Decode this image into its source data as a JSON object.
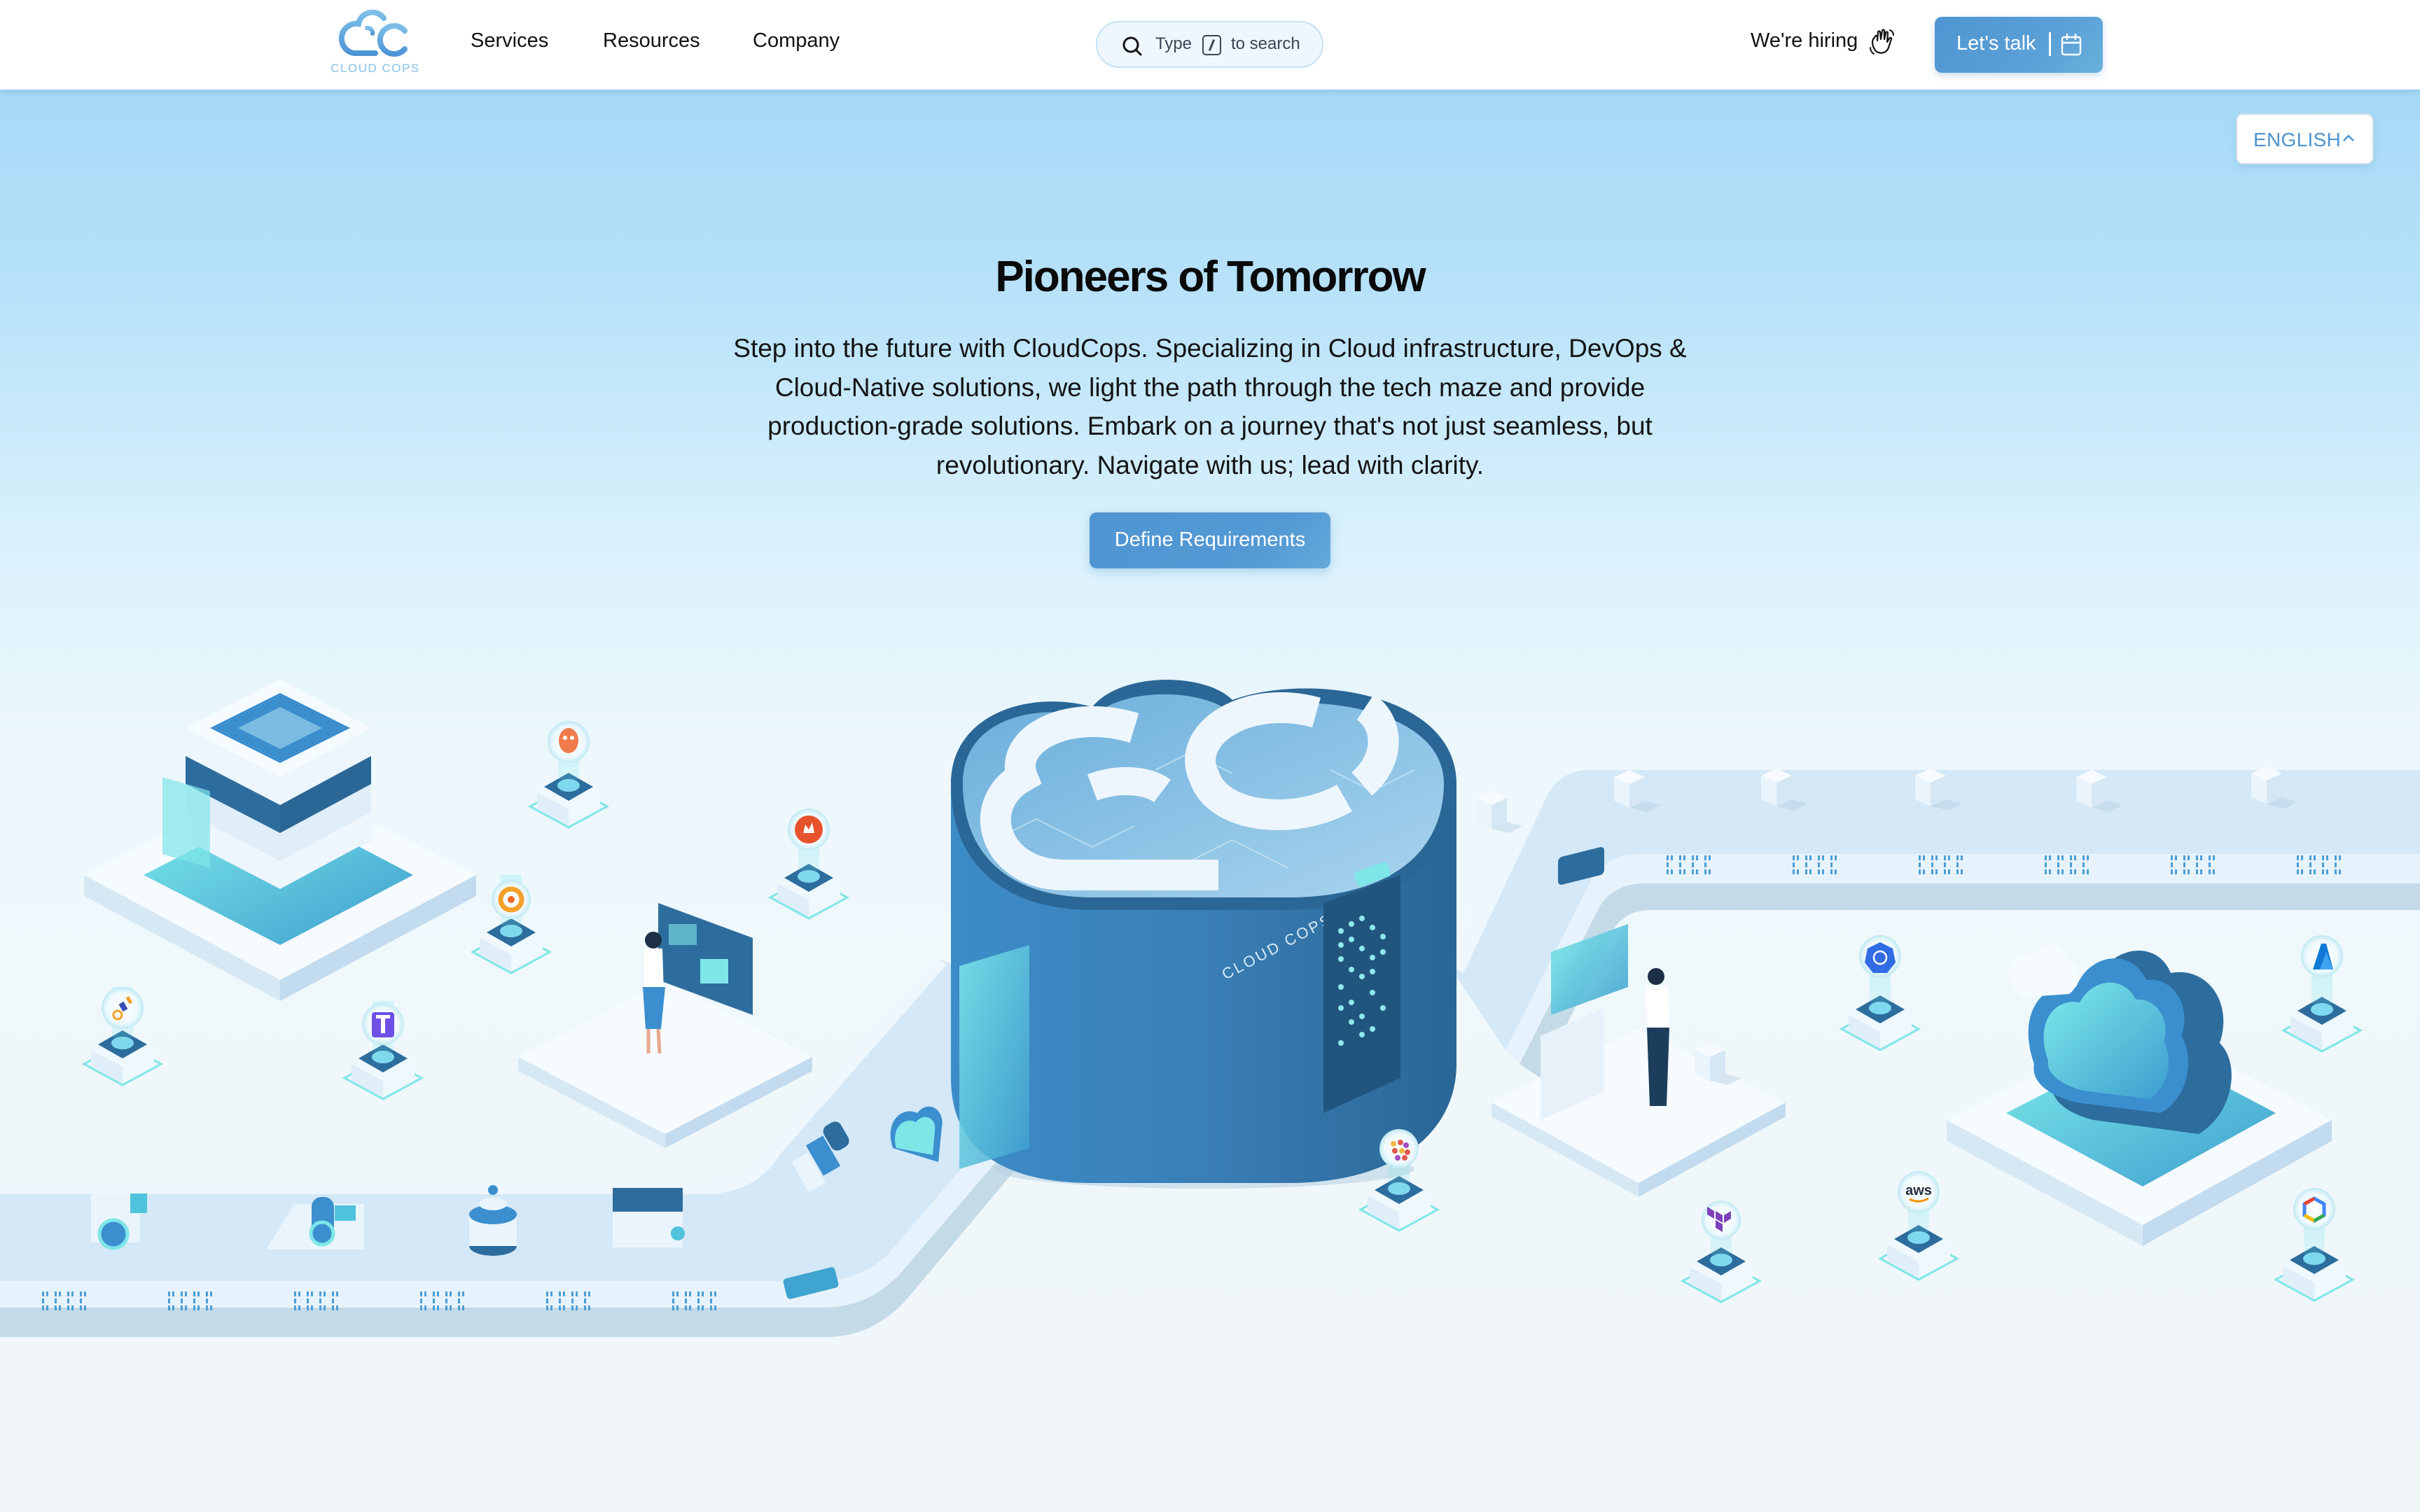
{
  "header": {
    "logo": {
      "name": "CLOUD COPS",
      "alt": "CloudCops logo"
    },
    "nav": [
      {
        "label": "Services"
      },
      {
        "label": "Resources"
      },
      {
        "label": "Company"
      }
    ],
    "search": {
      "prefix": "Type",
      "shortcut_key": "/",
      "suffix": "to search",
      "icon": "search-icon"
    },
    "hiring": {
      "label": "We're hiring",
      "icon": "waving-hand-icon"
    },
    "cta": {
      "label": "Let's talk",
      "icon": "calendar-icon"
    }
  },
  "language": {
    "selected": "ENGLISH",
    "icon": "chevron-up-icon"
  },
  "hero": {
    "title": "Pioneers of Tomorrow",
    "description": "Step into the future with CloudCops. Specializing in Cloud infrastructure, DevOps & Cloud-Native solutions, we light the path through the tech maze and provide production-grade solutions. Embark on a journey that's not just seamless, but revolutionary. Navigate with us; lead with clarity.",
    "button": "Define Requirements"
  },
  "illustration": {
    "server_label": "CLOUD COPS",
    "tool_badges": [
      {
        "name": "argo",
        "icon": "argo-octopus-icon"
      },
      {
        "name": "prometheus",
        "icon": "prometheus-flame-icon"
      },
      {
        "name": "grafana",
        "icon": "grafana-icon"
      },
      {
        "name": "keda",
        "icon": "pipeline-icon"
      },
      {
        "name": "traefik",
        "icon": "t-logo-icon"
      },
      {
        "name": "rancher",
        "icon": "dots-logo-icon"
      },
      {
        "name": "terraform",
        "icon": "terraform-icon"
      },
      {
        "name": "kubernetes",
        "icon": "kubernetes-helm-icon"
      },
      {
        "name": "aws",
        "icon": "aws-icon",
        "text": "aws"
      },
      {
        "name": "azure",
        "icon": "azure-icon"
      },
      {
        "name": "gcp",
        "icon": "google-cloud-icon"
      }
    ],
    "colors": {
      "primary": "#3f86c2",
      "dark": "#2b6796",
      "teal": "#6fe3e6",
      "belt": "#d3e8f7",
      "platform": "#f6fbff"
    }
  }
}
